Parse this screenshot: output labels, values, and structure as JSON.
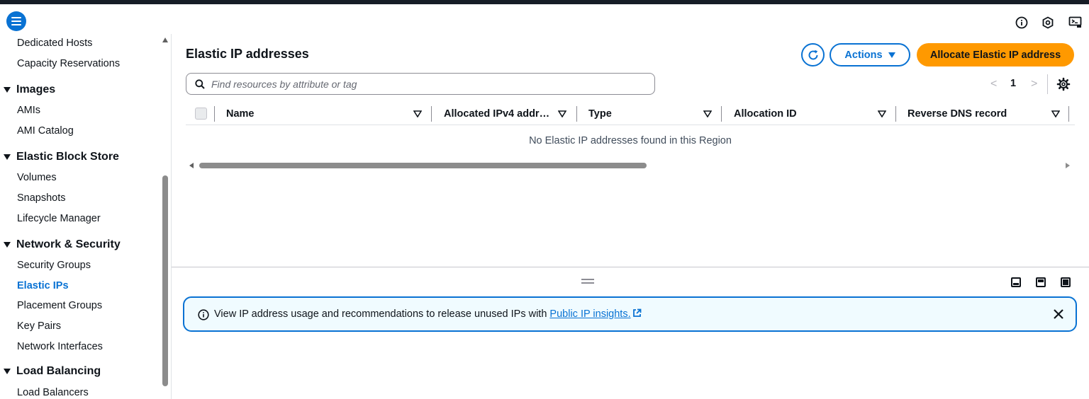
{
  "colors": {
    "accent": "#0972d3",
    "primary_button": "#ff9900",
    "topbar": "#161d26",
    "alert_bg": "#f0fbff"
  },
  "topbar": {
    "icons": [
      "menu-icon",
      "info-icon",
      "notifications-icon",
      "cloudshell-icon"
    ]
  },
  "sidebar": {
    "items": [
      {
        "label": "Dedicated Hosts"
      },
      {
        "label": "Capacity Reservations"
      },
      {
        "section": "Images"
      },
      {
        "label": "AMIs"
      },
      {
        "label": "AMI Catalog"
      },
      {
        "section": "Elastic Block Store"
      },
      {
        "label": "Volumes"
      },
      {
        "label": "Snapshots"
      },
      {
        "label": "Lifecycle Manager"
      },
      {
        "section": "Network & Security"
      },
      {
        "label": "Security Groups"
      },
      {
        "label": "Elastic IPs",
        "active": true
      },
      {
        "label": "Placement Groups"
      },
      {
        "label": "Key Pairs"
      },
      {
        "label": "Network Interfaces"
      },
      {
        "section": "Load Balancing"
      },
      {
        "label": "Load Balancers"
      }
    ]
  },
  "main": {
    "title": "Elastic IP addresses",
    "actions_label": "Actions",
    "allocate_label": "Allocate Elastic IP address",
    "search": {
      "placeholder": "Find resources by attribute or tag",
      "value": ""
    },
    "pager": {
      "current_page": "1",
      "prev": "<",
      "next": ">"
    },
    "table": {
      "columns": [
        "Name",
        "Allocated IPv4 addr…",
        "Type",
        "Allocation ID",
        "Reverse DNS record"
      ],
      "empty_message": "No Elastic IP addresses found in this Region"
    }
  },
  "alert": {
    "message": "View IP address usage and recommendations to release unused IPs with",
    "link_label": "Public IP insights."
  }
}
